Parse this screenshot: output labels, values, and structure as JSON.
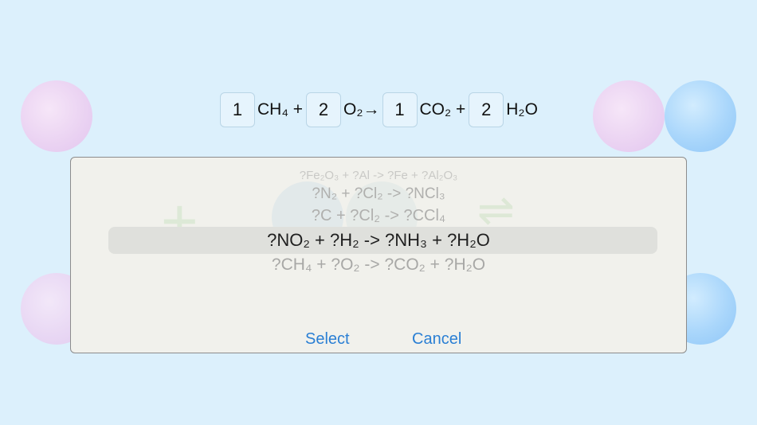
{
  "equation": {
    "coefficients": [
      "1",
      "2",
      "1",
      "2"
    ],
    "terms": [
      "CH₄ +",
      "O₂",
      "CO₂ +",
      "H₂O"
    ],
    "arrow": "→"
  },
  "picker": {
    "options": [
      "?Fe₂O₃ + ?Al -> ?Fe + ?Al₂O₃",
      "?N₂ + ?Cl₂ -> ?NCl₃",
      "?C + ?Cl₂ -> ?CCl₄",
      "?NO₂ + ?H₂ -> ?NH₃ + ?H₂O",
      "?CH₄ + ?O₂ -> ?CO₂ + ?H₂O"
    ],
    "selected_index": 3
  },
  "dialog": {
    "select_label": "Select",
    "cancel_label": "Cancel"
  },
  "colors": {
    "background": "#dcf0fc",
    "accent": "#2a7fd4",
    "dialog_bg": "#f1f1ec"
  }
}
